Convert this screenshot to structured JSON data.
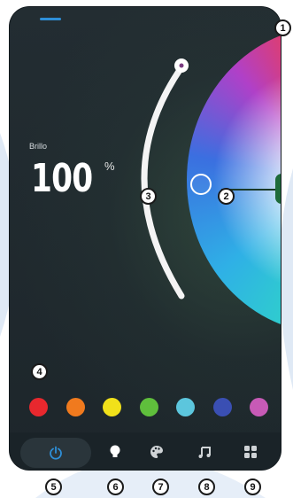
{
  "brightness": {
    "label": "Brillo",
    "value": "100",
    "unit": "%",
    "level_percent": 100
  },
  "color_swatches": [
    {
      "name": "red",
      "color": "#e8282e"
    },
    {
      "name": "orange",
      "color": "#f07a1e"
    },
    {
      "name": "yellow",
      "color": "#f1e11a"
    },
    {
      "name": "green",
      "color": "#5fbf3c"
    },
    {
      "name": "cyan",
      "color": "#5cc6dd"
    },
    {
      "name": "blue",
      "color": "#3a4fb3"
    },
    {
      "name": "magenta",
      "color": "#c75ab6"
    }
  ],
  "bottom_nav": [
    {
      "name": "power",
      "icon": "power-icon"
    },
    {
      "name": "bulb",
      "icon": "bulb-icon"
    },
    {
      "name": "palette",
      "icon": "palette-icon"
    },
    {
      "name": "music",
      "icon": "music-icon"
    },
    {
      "name": "grid",
      "icon": "grid-icon"
    }
  ],
  "callouts": {
    "c1": "1",
    "c2": "2",
    "c3": "3",
    "c4": "4",
    "c5": "5",
    "c6": "6",
    "c7": "7",
    "c8": "8",
    "c9": "9"
  },
  "colors": {
    "accent": "#2e8fd8",
    "panel": "#1f2a30",
    "callout_border": "#1a1a1a"
  }
}
